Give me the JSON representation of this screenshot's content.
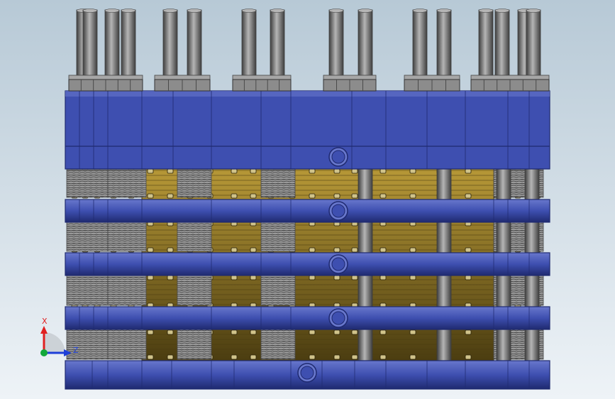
{
  "viewport": {
    "background_top": "#b7c9d6",
    "background_bottom": "#eef3f7"
  },
  "model": {
    "colors": {
      "plate": "#3e4fb0",
      "plate_dark": "#1f2a70",
      "plate_light": "#6877cc",
      "spacer": "#8a7220",
      "spacer_dark": "#4a3c10",
      "spacer_light": "#b99a38",
      "rod": "#7d7d7d",
      "rod_dark": "#3e3e3e",
      "rod_light": "#b5b5b5",
      "spring": "#9a9a9a",
      "spring_dark": "#4a4a4a",
      "nut": "#8c8c8c"
    }
  },
  "triad": {
    "x_label": "X",
    "z_label": "Z",
    "x_color": "#e02020",
    "z_color": "#1e3fd8",
    "y_color": "#12a83a"
  }
}
